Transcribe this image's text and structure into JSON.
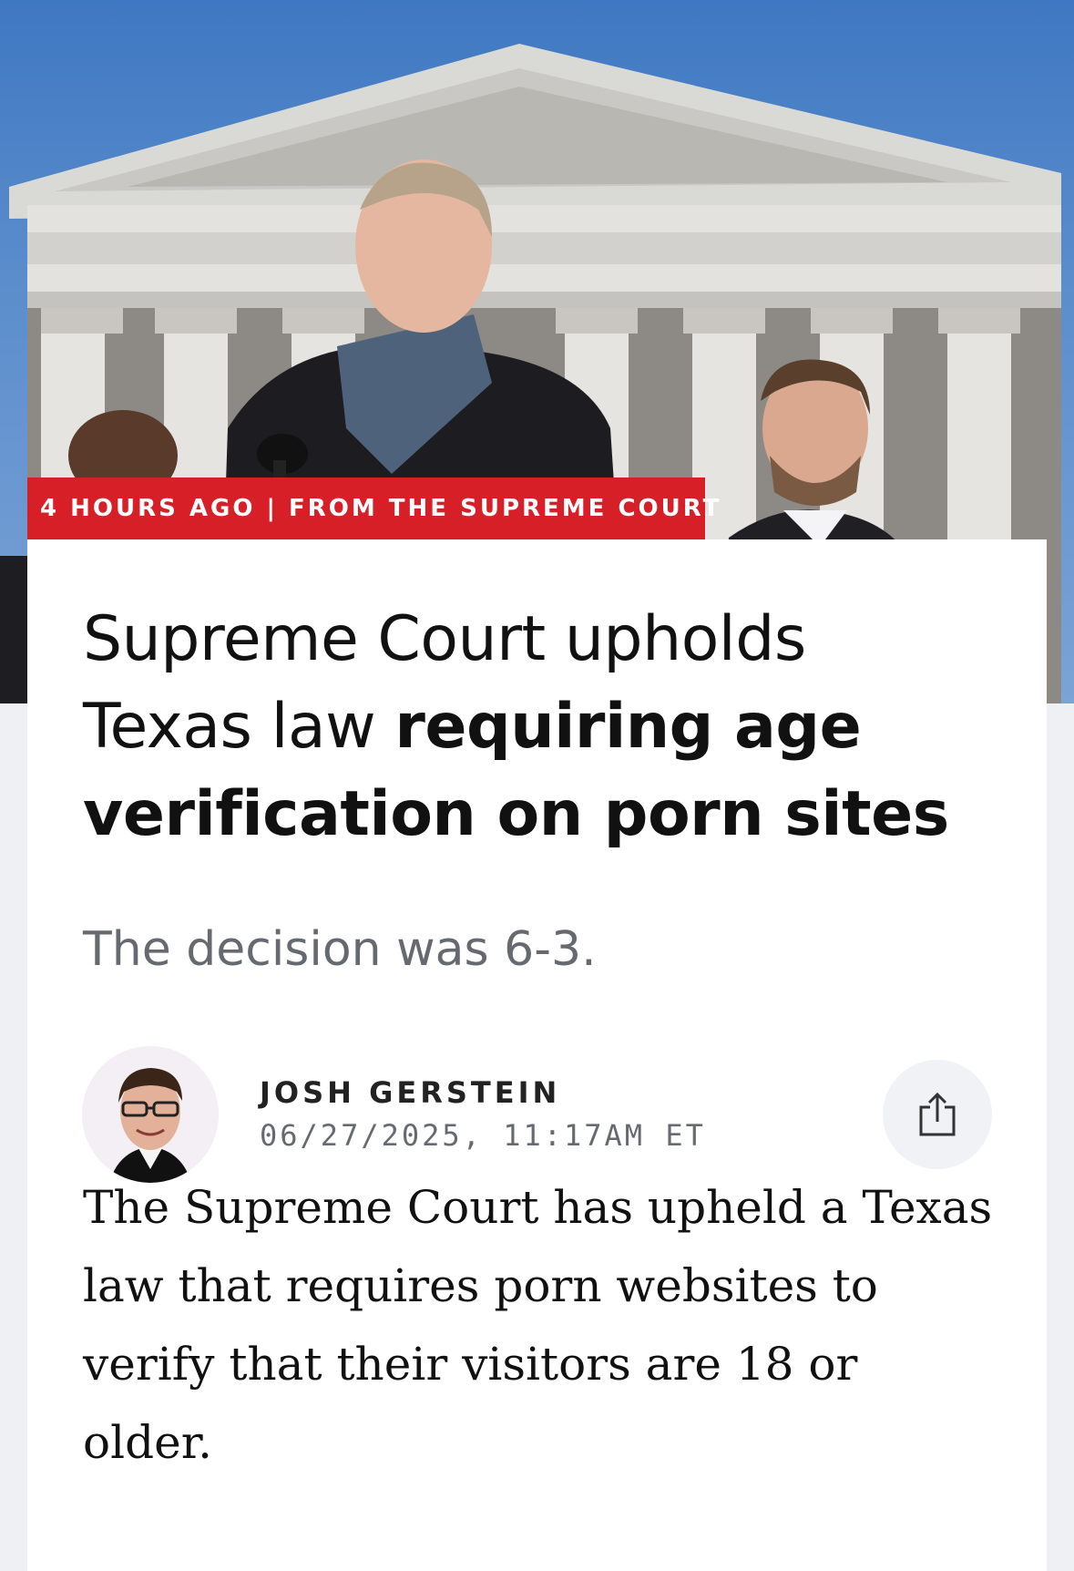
{
  "hero": {
    "image": "Supreme Court building with speaker at microphone"
  },
  "tag": {
    "time": "4 HOURS AGO",
    "separator": "|",
    "section": "FROM THE SUPREME COURT"
  },
  "article": {
    "headline_regular": "Supreme Court upholds Texas law ",
    "headline_bold": "requiring age verification on porn sites",
    "dek": "The decision was 6-3.",
    "author": "JOSH GERSTEIN",
    "date": "06/27/2025, 11:17AM ET",
    "body": "The Supreme Court has upheld a Texas law that requires porn websites to verify that their visitors are 18 or older."
  },
  "icons": {
    "share": "share-icon"
  },
  "colors": {
    "tag_red": "#d61f26",
    "dek_gray": "#666a70",
    "page_gray": "#eef0f3"
  }
}
